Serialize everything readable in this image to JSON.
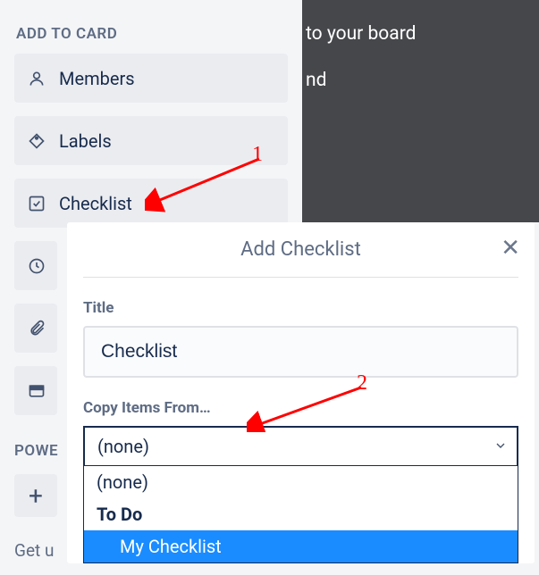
{
  "background": {
    "line1": "to your board",
    "line2": "nd"
  },
  "sidebar": {
    "header": "ADD TO CARD",
    "items": [
      {
        "label": "Members",
        "icon": "person-icon"
      },
      {
        "label": "Labels",
        "icon": "label-icon"
      },
      {
        "label": "Checklist",
        "icon": "checkbox-icon"
      },
      {
        "label": "",
        "icon": "clock-icon"
      },
      {
        "label": "",
        "icon": "attachment-icon"
      },
      {
        "label": "",
        "icon": "cover-icon"
      }
    ],
    "powerups_header": "POWE",
    "get_started": "Get u"
  },
  "popover": {
    "title": "Add Checklist",
    "title_label": "Title",
    "title_value": "Checklist",
    "copy_label": "Copy Items From…",
    "select_value": "(none)",
    "options": [
      {
        "label": "(none)",
        "selected": false,
        "indent": 0,
        "bold": false
      },
      {
        "label": "To Do",
        "selected": false,
        "indent": 0,
        "bold": true
      },
      {
        "label": "My Checklist",
        "selected": true,
        "indent": 1,
        "bold": false
      }
    ]
  },
  "annotations": {
    "n1": "1",
    "n2": "2"
  }
}
